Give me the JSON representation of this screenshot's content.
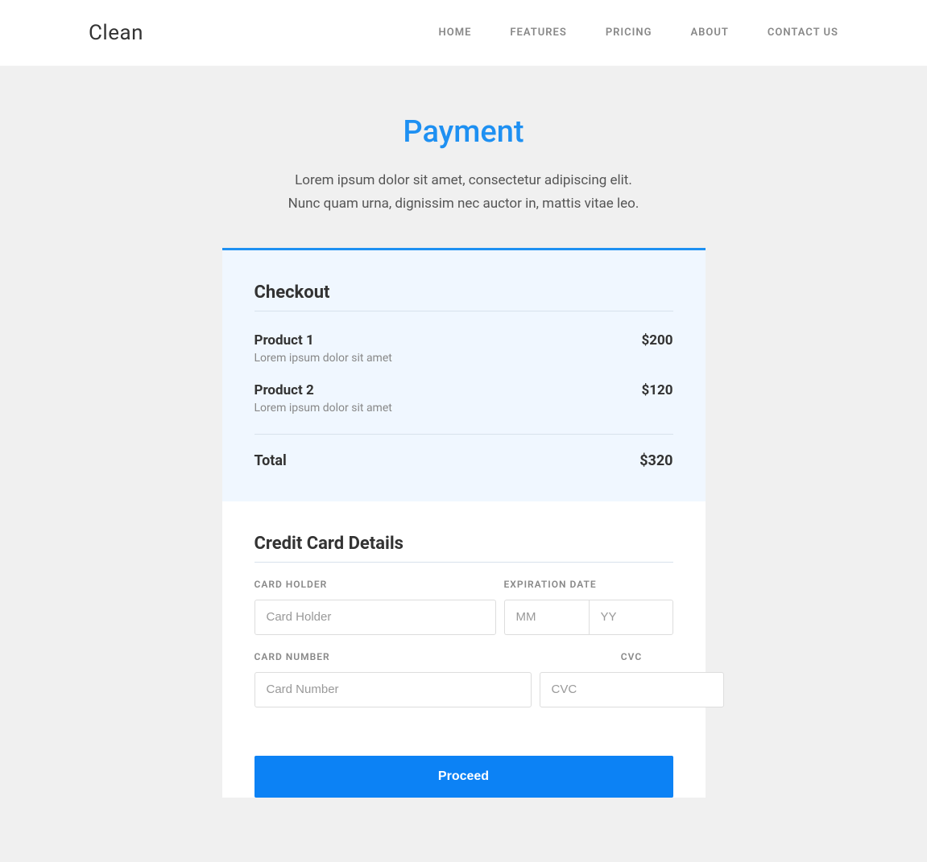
{
  "header": {
    "brand": "Clean",
    "nav": [
      "HOME",
      "FEATURES",
      "PRICING",
      "ABOUT",
      "CONTACT US"
    ]
  },
  "page": {
    "title": "Payment",
    "subtitle": "Lorem ipsum dolor sit amet, consectetur adipiscing elit. Nunc quam urna, dignissim nec auctor in, mattis vitae leo."
  },
  "checkout": {
    "heading": "Checkout",
    "items": [
      {
        "name": "Product 1",
        "desc": "Lorem ipsum dolor sit amet",
        "price": "$200"
      },
      {
        "name": "Product 2",
        "desc": "Lorem ipsum dolor sit amet",
        "price": "$120"
      }
    ],
    "total_label": "Total",
    "total_value": "$320"
  },
  "cc": {
    "heading": "Credit Card Details",
    "card_holder_label": "CARD HOLDER",
    "card_holder_placeholder": "Card Holder",
    "expiration_label": "EXPIRATION DATE",
    "mm_placeholder": "MM",
    "yy_placeholder": "YY",
    "card_number_label": "CARD NUMBER",
    "card_number_placeholder": "Card Number",
    "cvc_label": "CVC",
    "cvc_placeholder": "CVC"
  },
  "proceed_label": "Proceed"
}
